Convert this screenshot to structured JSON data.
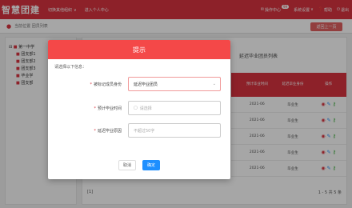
{
  "header": {
    "brand": "智慧团建",
    "nav_org": "切换其他组织",
    "nav_org_caret": "∨",
    "nav_personal": "进入个人中心",
    "notify_badge": "99",
    "notify_label": "操作中心",
    "settings_label": "系统设置",
    "settings_caret": "∨",
    "help_label": "帮助",
    "logout_label": "退出"
  },
  "breadcrumb": {
    "text": "当前位置 团员列表"
  },
  "back_button": "返回上一页",
  "tree": {
    "root": "第一中学",
    "items": [
      "团支部1",
      "团支部2",
      "团支部3",
      "毕业学",
      "团支部"
    ]
  },
  "main": {
    "title": "延迟毕业团员列表",
    "headers": [
      "预计毕业时间",
      "延迟毕业身份",
      "操作"
    ],
    "rows": [
      {
        "date": "2021-06",
        "status": "毕业生"
      },
      {
        "date": "2021-06",
        "status": "毕业生"
      },
      {
        "date": "2021-06",
        "status": "毕业生"
      },
      {
        "date": "2021-06",
        "status": "毕业生"
      },
      {
        "date": "2021-06",
        "status": "毕业生"
      }
    ],
    "footer_left": "[1]",
    "footer_right": "1 - 5  共 5 条"
  },
  "modal": {
    "title": "提示",
    "hint": "请选择以下信息：",
    "fields": [
      {
        "label": "被标记成员身份",
        "value": "延迟毕业团员",
        "placeholder": ""
      },
      {
        "label": "预计毕业时间",
        "value": "",
        "placeholder": "请选择"
      },
      {
        "label": "延迟毕业原因",
        "value": "",
        "placeholder": "不超过50字"
      }
    ],
    "cancel": "取消",
    "confirm": "确定"
  },
  "colors": {
    "brand_red": "#d9333f",
    "modal_header": "#f44848",
    "confirm_blue": "#1e8fff"
  },
  "icons": {
    "actions": [
      "eye-icon",
      "edit-icon",
      "key-icon"
    ]
  }
}
